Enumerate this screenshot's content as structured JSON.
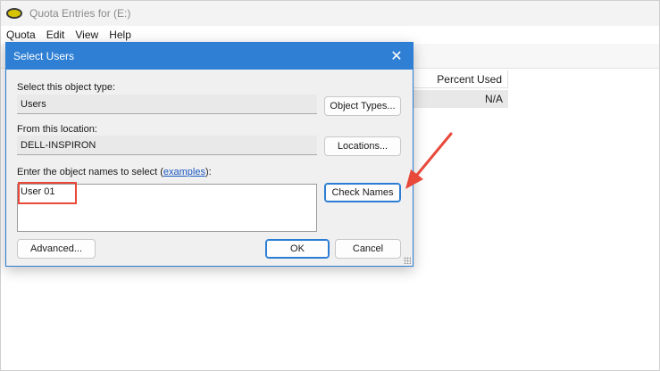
{
  "background_window": {
    "title": "Quota Entries for  (E:)",
    "menu": [
      "Quota",
      "Edit",
      "View",
      "Help"
    ],
    "table": {
      "column_header": "Percent Used",
      "cell_value": "N/A"
    }
  },
  "dialog": {
    "title": "Select Users",
    "object_type": {
      "label": "Select this object type:",
      "value": "Users",
      "button": "Object Types..."
    },
    "location": {
      "label": "From this location:",
      "value": "DELL-INSPIRON",
      "button": "Locations..."
    },
    "names": {
      "label_prefix": "Enter the object names to select (",
      "link": "examples",
      "label_suffix": "):",
      "value": "User 01",
      "check_button": "Check Names"
    },
    "buttons": {
      "advanced": "Advanced...",
      "ok": "OK",
      "cancel": "Cancel"
    }
  },
  "colors": {
    "accent": "#2f7fd4",
    "annotation": "#e8493a"
  }
}
